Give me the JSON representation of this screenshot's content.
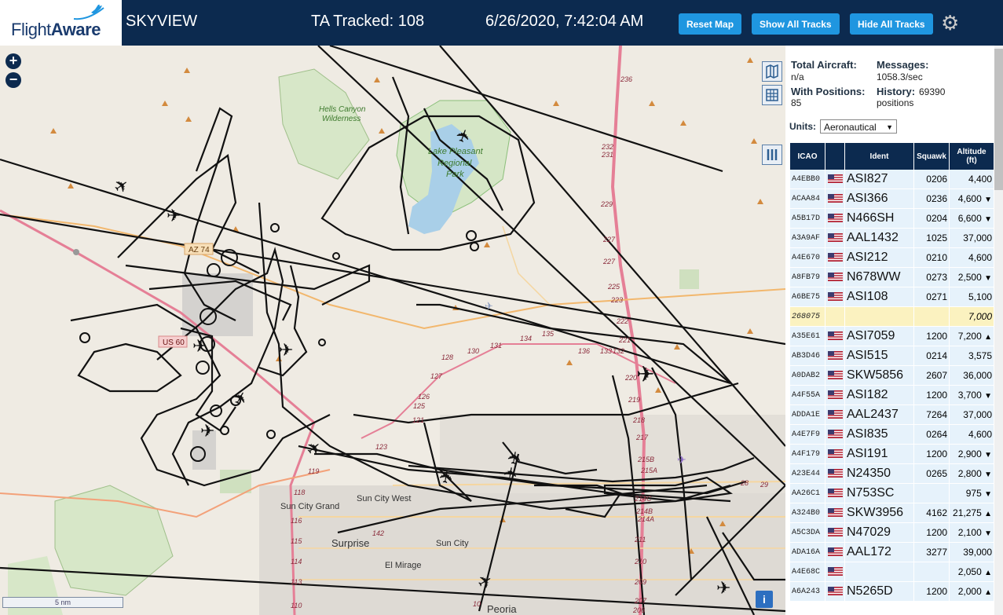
{
  "header": {
    "logo_text_light": "Flight",
    "logo_text_bold": "Aware",
    "app_title": "SKYVIEW",
    "tracked_text": "TA Tracked: 108",
    "clock_text": "6/26/2020, 7:42:04 AM",
    "buttons": {
      "reset_map": "Reset Map",
      "show_all_tracks": "Show All Tracks",
      "hide_all_tracks": "Hide All Tracks"
    },
    "bg_color": "#0c2a4f",
    "button_color": "#1f96e0"
  },
  "stats": {
    "total_aircraft_label": "Total Aircraft:",
    "total_aircraft_value": "n/a",
    "messages_label": "Messages:",
    "messages_value": "1058.3/sec",
    "with_positions_label": "With Positions:",
    "with_positions_value": "85",
    "history_label": "History:",
    "history_value_1": "69390",
    "history_value_2": "positions"
  },
  "units": {
    "label": "Units:",
    "selected": "Aeronautical"
  },
  "table": {
    "columns": [
      "ICAO",
      "",
      "Ident",
      "Squawk",
      "Altitude (ft)"
    ],
    "rows": [
      {
        "icao": "A4EBB0",
        "flag": "us",
        "ident": "ASI827",
        "squawk": "0206",
        "altitude": "4,400",
        "trend": ""
      },
      {
        "icao": "ACAA84",
        "flag": "us",
        "ident": "ASI366",
        "squawk": "0236",
        "altitude": "4,600",
        "trend": "▼"
      },
      {
        "icao": "A5B17D",
        "flag": "us",
        "ident": "N466SH",
        "squawk": "0204",
        "altitude": "6,600",
        "trend": "▼"
      },
      {
        "icao": "A3A9AF",
        "flag": "us",
        "ident": "AAL1432",
        "squawk": "1025",
        "altitude": "37,000",
        "trend": ""
      },
      {
        "icao": "A4E670",
        "flag": "us",
        "ident": "ASI212",
        "squawk": "0210",
        "altitude": "4,600",
        "trend": ""
      },
      {
        "icao": "A8FB79",
        "flag": "us",
        "ident": "N678WW",
        "squawk": "0273",
        "altitude": "2,500",
        "trend": "▼"
      },
      {
        "icao": "A6BE75",
        "flag": "us",
        "ident": "ASI108",
        "squawk": "0271",
        "altitude": "5,100",
        "trend": ""
      },
      {
        "icao": "268075",
        "flag": "",
        "ident": "",
        "squawk": "",
        "altitude": "7,000",
        "trend": "",
        "highlight": true
      },
      {
        "icao": "A35E61",
        "flag": "us",
        "ident": "ASI7059",
        "squawk": "1200",
        "altitude": "7,200",
        "trend": "▲"
      },
      {
        "icao": "AB3D46",
        "flag": "us",
        "ident": "ASI515",
        "squawk": "0214",
        "altitude": "3,575",
        "trend": ""
      },
      {
        "icao": "A0DAB2",
        "flag": "us",
        "ident": "SKW5856",
        "squawk": "2607",
        "altitude": "36,000",
        "trend": ""
      },
      {
        "icao": "A4F55A",
        "flag": "us",
        "ident": "ASI182",
        "squawk": "1200",
        "altitude": "3,700",
        "trend": "▼"
      },
      {
        "icao": "ADDA1E",
        "flag": "us",
        "ident": "AAL2437",
        "squawk": "7264",
        "altitude": "37,000",
        "trend": ""
      },
      {
        "icao": "A4E7F9",
        "flag": "us",
        "ident": "ASI835",
        "squawk": "0264",
        "altitude": "4,600",
        "trend": ""
      },
      {
        "icao": "A4F179",
        "flag": "us",
        "ident": "ASI191",
        "squawk": "1200",
        "altitude": "2,900",
        "trend": "▼"
      },
      {
        "icao": "A23E44",
        "flag": "us",
        "ident": "N24350",
        "squawk": "0265",
        "altitude": "2,800",
        "trend": "▼"
      },
      {
        "icao": "AA26C1",
        "flag": "us",
        "ident": "N753SC",
        "squawk": "",
        "altitude": "975",
        "trend": "▼"
      },
      {
        "icao": "A324B0",
        "flag": "us",
        "ident": "SKW3956",
        "squawk": "4162",
        "altitude": "21,275",
        "trend": "▲"
      },
      {
        "icao": "A5C3DA",
        "flag": "us",
        "ident": "N47029",
        "squawk": "1200",
        "altitude": "2,100",
        "trend": "▼"
      },
      {
        "icao": "ADA16A",
        "flag": "us",
        "ident": "AAL172",
        "squawk": "3277",
        "altitude": "39,000",
        "trend": ""
      },
      {
        "icao": "A4E68C",
        "flag": "us",
        "ident": "",
        "squawk": "",
        "altitude": "2,050",
        "trend": "▲"
      },
      {
        "icao": "A6A243",
        "flag": "us",
        "ident": "N5265D",
        "squawk": "1200",
        "altitude": "2,000",
        "trend": "▲"
      }
    ]
  },
  "map": {
    "scale_label": "5 nm",
    "zoom_in": "+",
    "zoom_out": "−",
    "info": "i",
    "labels": {
      "hells_canyon": "Hells Canyon",
      "wilderness": "Wilderness",
      "lake_pleasant_1": "Lake Pleasant",
      "lake_pleasant_2": "Regional",
      "lake_pleasant_3": "Park",
      "az74": "AZ 74",
      "us60": "US 60",
      "sun_city_grand": "Sun City Grand",
      "sun_city_west": "Sun City West",
      "surprise": "Surprise",
      "sun_city": "Sun City",
      "el_mirage": "El Mirage",
      "peoria": "Peoria"
    },
    "highway_numbers": [
      "236",
      "232",
      "231",
      "229",
      "227",
      "227",
      "225",
      "223",
      "222",
      "221",
      "220",
      "219",
      "218",
      "217",
      "215B",
      "215A",
      "214C",
      "214B",
      "214A",
      "211",
      "210",
      "209",
      "207",
      "206",
      "28",
      "29",
      "119",
      "118",
      "116",
      "115",
      "114",
      "113",
      "110",
      "142",
      "123",
      "121",
      "131",
      "130",
      "128",
      "127",
      "126",
      "125",
      "136",
      "135",
      "134",
      "133",
      "132",
      "10"
    ]
  }
}
